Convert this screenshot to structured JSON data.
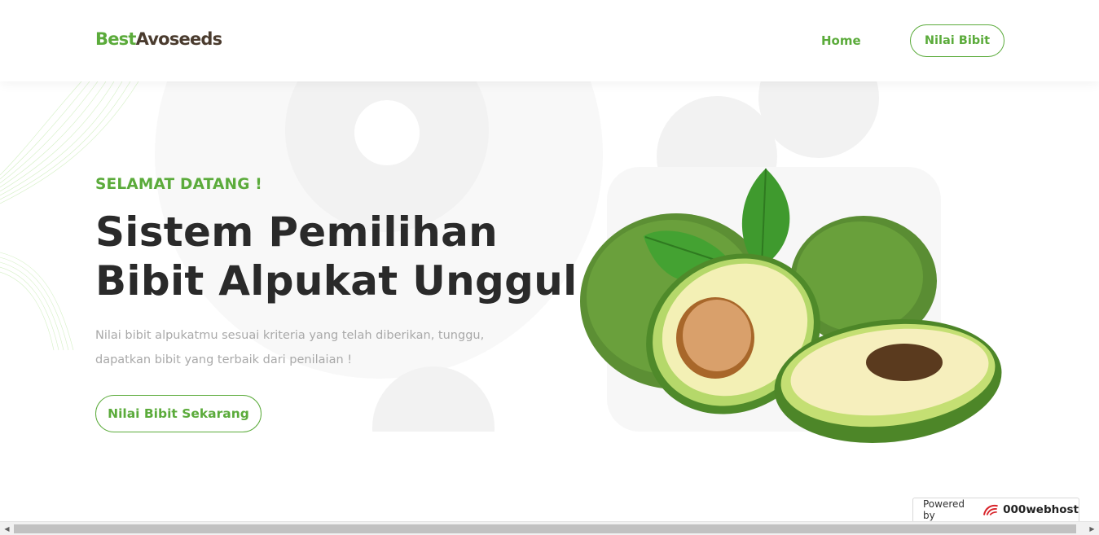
{
  "header": {
    "logo": {
      "part1": "Best",
      "part2": "Avoseeds"
    },
    "nav": {
      "home_label": "Home",
      "cta_label": "Nilai Bibit"
    }
  },
  "hero": {
    "eyebrow": "SELAMAT DATANG !",
    "title_line1": "Sistem Pemilihan",
    "title_line2": "Bibit Alpukat Unggul",
    "description": "Nilai bibit alpukatmu sesuai kriteria yang telah diberikan, tunggu, dapatkan bibit yang terbaik dari penilaian !",
    "cta_label": "Nilai Bibit Sekarang",
    "image_icon": "avocado-illustration"
  },
  "footer_badge": {
    "prefix": "Powered by",
    "brand": "000webhost"
  },
  "colors": {
    "accent": "#5bab3b",
    "logo_dark": "#4a3b2e",
    "heading": "#2a2a2a",
    "muted": "#a9a9a9"
  }
}
